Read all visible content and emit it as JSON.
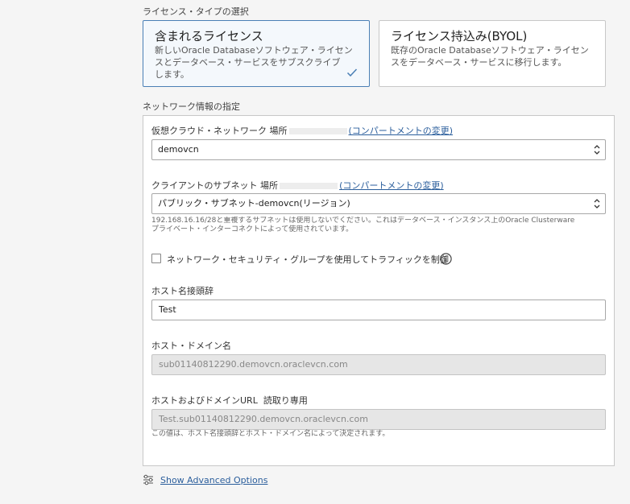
{
  "license": {
    "section_label": "ライセンス・タイプの選択",
    "options": [
      {
        "title": "含まれるライセンス",
        "desc1": "新しいOracle Databaseソフトウェア・ライセン",
        "desc2": "スとデータベース・サービスをサブスクライブ",
        "desc3": "します。",
        "selected": true
      },
      {
        "title": "ライセンス持込み(BYOL)",
        "desc1": "既存のOracle Databaseソフトウェア・ライセン",
        "desc2": "スをデータベース・サービスに移行します。",
        "desc3": "",
        "selected": false
      }
    ]
  },
  "network": {
    "section_label": "ネットワーク情報の指定",
    "vcn_label": "仮想クラウド・ネットワーク 場所",
    "vcn_link": "(コンパートメントの変更)",
    "vcn_value": "demovcn",
    "subnet_label": "クライアントのサブネット 場所",
    "subnet_link": "(コンパートメントの変更)",
    "subnet_value": "パブリック・サブネット-demovcn(リージョン)",
    "subnet_help1": "192.168.16.16/28と重複するサブネットは使用しないでください。これはデータベース・インスタンス上のOracle Clusterware",
    "subnet_help2": "プライベート・インターコネクトによって使用されています。",
    "nsg_label": "ネットワーク・セキュリティ・グループを使用してトラフィックを制御",
    "hostname_label": "ホスト名接頭辞",
    "hostname_value": "Test",
    "domain_label": "ホスト・ドメイン名",
    "domain_value": "sub01140812290.demovcn.oraclevcn.com",
    "url_label": "ホストおよびドメインURL  読取り専用",
    "url_value": "Test.sub01140812290.demovcn.oraclevcn.com",
    "url_help": "この値は、ホスト名接頭辞とホスト・ドメイン名によって決定されます。"
  },
  "advanced": {
    "link": "Show Advanced Options",
    "icon": "sliders-icon"
  },
  "colors": {
    "accent": "#4a7fb5",
    "link": "#2b5e9c",
    "selected_bg": "#f4f8fc",
    "check": "#4a7fb5"
  }
}
